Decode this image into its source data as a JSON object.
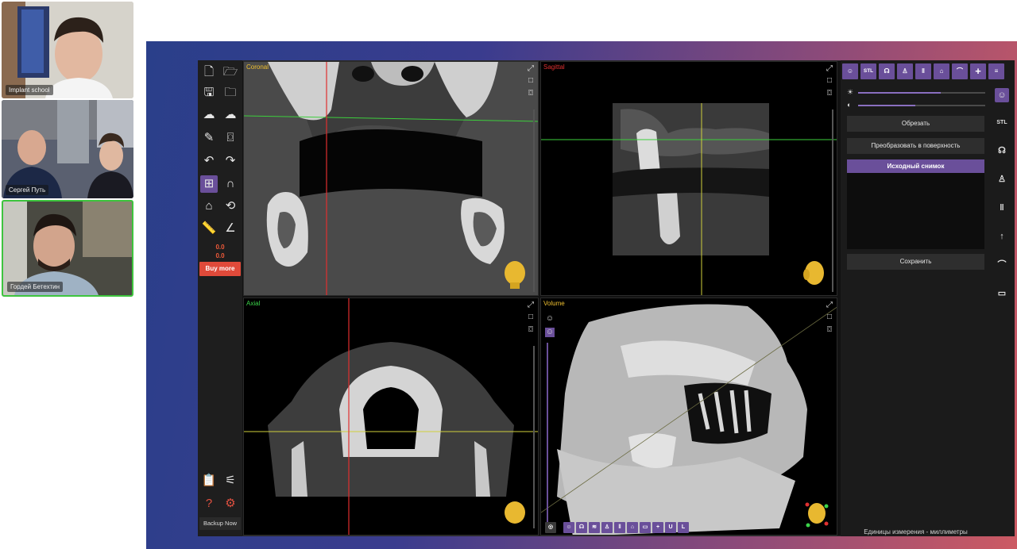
{
  "participants": [
    {
      "name": "Implant school"
    },
    {
      "name": "Сергей Путь"
    },
    {
      "name": "Гордей Бетехтин"
    }
  ],
  "left_toolbar": {
    "coord_top": "0.0",
    "coord_bottom": "0.0",
    "buy_more": "Buy more",
    "backup": "Backup Now"
  },
  "views": {
    "coronal": {
      "label": "Coronal",
      "color": "#ff3b3b"
    },
    "sagittal": {
      "label": "Sagittal",
      "color": "#ff3b3b"
    },
    "axial": {
      "label": "Axial",
      "color": "#3bd44a"
    },
    "volume": {
      "label": "Volume",
      "color": "#f0c030"
    }
  },
  "top_tabs": [
    "STL"
  ],
  "side_tabs": [
    "STL"
  ],
  "right_panel": {
    "brightness_level": 0.65,
    "contrast_level": 0.45,
    "trim_button": "Обрезать",
    "convert_button": "Преобразовать в поверхность",
    "source_item": "Исходный снимок",
    "save_button": "Сохранить",
    "units": "Единицы измерения - миллиметры"
  },
  "volume_toolbar": [
    "U",
    "L"
  ]
}
